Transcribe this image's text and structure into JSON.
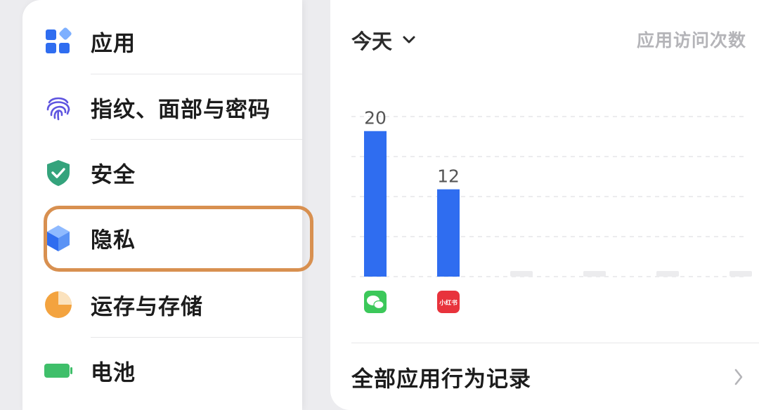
{
  "menu": {
    "items": [
      {
        "label": "应用",
        "icon": "app-grid-icon"
      },
      {
        "label": "指纹、面部与密码",
        "icon": "fingerprint-icon"
      },
      {
        "label": "安全",
        "icon": "shield-check-icon"
      },
      {
        "label": "隐私",
        "icon": "privacy-cube-icon",
        "selected": true
      },
      {
        "label": "运存与存储",
        "icon": "storage-pie-icon"
      },
      {
        "label": "电池",
        "icon": "battery-icon"
      }
    ],
    "highlight_color": "#d89050"
  },
  "detail": {
    "period_label": "今天",
    "metric_label": "应用访问次数",
    "footer_label": "全部应用行为记录"
  },
  "chart_data": {
    "type": "bar",
    "categories": [
      "微信",
      "小红书",
      "",
      "",
      "",
      ""
    ],
    "values": [
      20,
      12,
      0,
      0,
      0,
      0
    ],
    "data_labels": [
      "20",
      "12",
      "",
      "",
      "",
      ""
    ],
    "ylim": [
      0,
      22
    ],
    "grid": true,
    "bar_color": "#2f6df0",
    "empty_color": "#ececee",
    "app_icons": [
      {
        "name": "wechat-icon",
        "color": "#3cc85a"
      },
      {
        "name": "xiaohongshu-icon",
        "color": "#e8333c",
        "text": "小红书"
      }
    ]
  }
}
